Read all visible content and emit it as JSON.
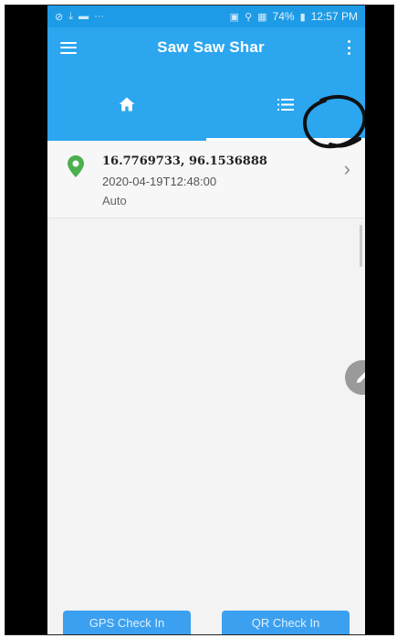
{
  "status_bar": {
    "left_icons": [
      "no-disturb-icon",
      "download-icon",
      "video-icon",
      "more-dots-icon"
    ],
    "battery": "74%",
    "time": "12:57 PM"
  },
  "app_bar": {
    "title": "Saw Saw Shar"
  },
  "tabs": [
    {
      "icon": "home-icon",
      "active": false
    },
    {
      "icon": "list-icon",
      "active": true
    }
  ],
  "entries": [
    {
      "coords": "16.7769733, 96.1536888",
      "timestamp": "2020-04-19T12:48:00",
      "mode": "Auto"
    }
  ],
  "buttons": {
    "gps_label": "GPS Check In",
    "qr_label": "QR Check In"
  },
  "colors": {
    "primary": "#2ba6ef",
    "status_bar": "#1e9be6",
    "pin": "#4caf50",
    "fab": "#9a9a9a"
  }
}
